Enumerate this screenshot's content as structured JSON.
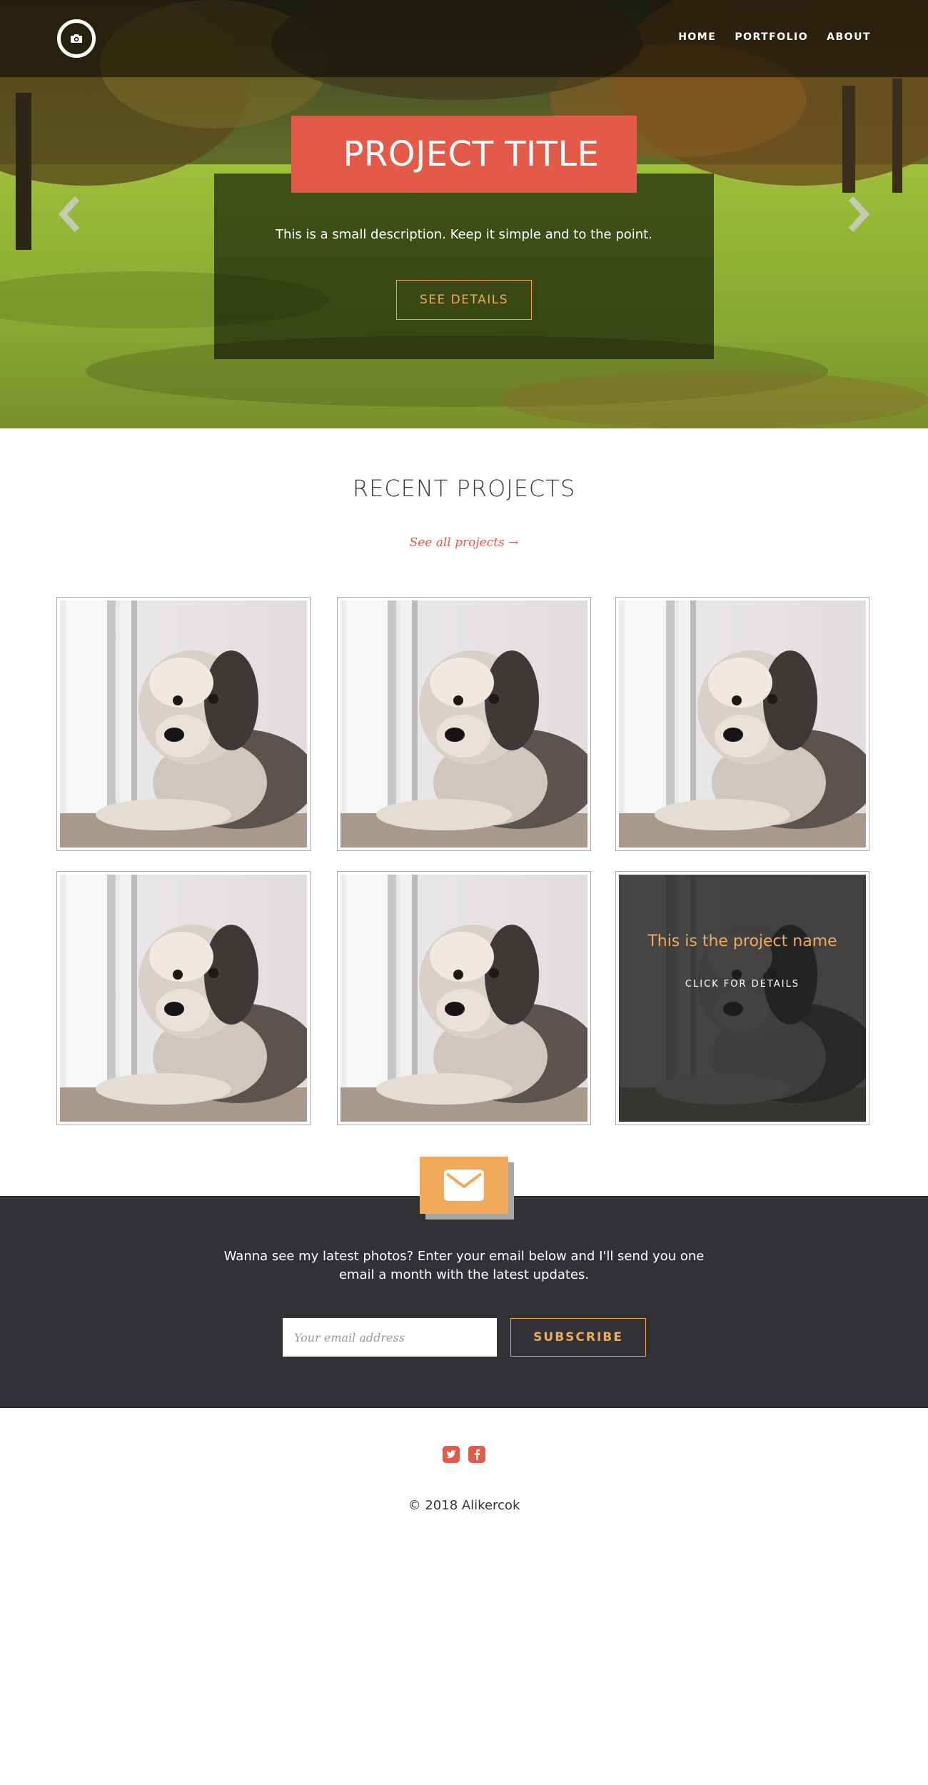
{
  "brand": {
    "logo_icon": "camera-icon"
  },
  "nav": {
    "items": [
      "HOME",
      "PORTFOLIO",
      "ABOUT"
    ]
  },
  "hero": {
    "title": "PROJECT TITLE",
    "description": "This is a small description. Keep it simple and to the point.",
    "button": "SEE DETAILS",
    "prev_icon": "chevron-left-icon",
    "next_icon": "chevron-right-icon"
  },
  "recent": {
    "title": "RECENT PROJECTS",
    "see_all": "See all projects →",
    "projects": [
      {
        "image": "dog-photo"
      },
      {
        "image": "dog-photo"
      },
      {
        "image": "dog-photo"
      },
      {
        "image": "dog-photo"
      },
      {
        "image": "dog-photo"
      },
      {
        "image": "dog-photo",
        "name": "This is the project name",
        "cta": "CLICK FOR DETAILS"
      }
    ]
  },
  "newsletter": {
    "icon": "envelope-icon",
    "text": "Wanna see my latest photos? Enter your email below and I'll send you one email a month with the latest updates.",
    "placeholder": "Your email address",
    "button": "SUBSCRIBE"
  },
  "footer": {
    "social": [
      "twitter-icon",
      "facebook-icon"
    ],
    "copyright": "© 2018 Alikercok"
  },
  "colors": {
    "accent": "#e45a48",
    "orange": "#f0aa5a",
    "dark": "#313236"
  }
}
